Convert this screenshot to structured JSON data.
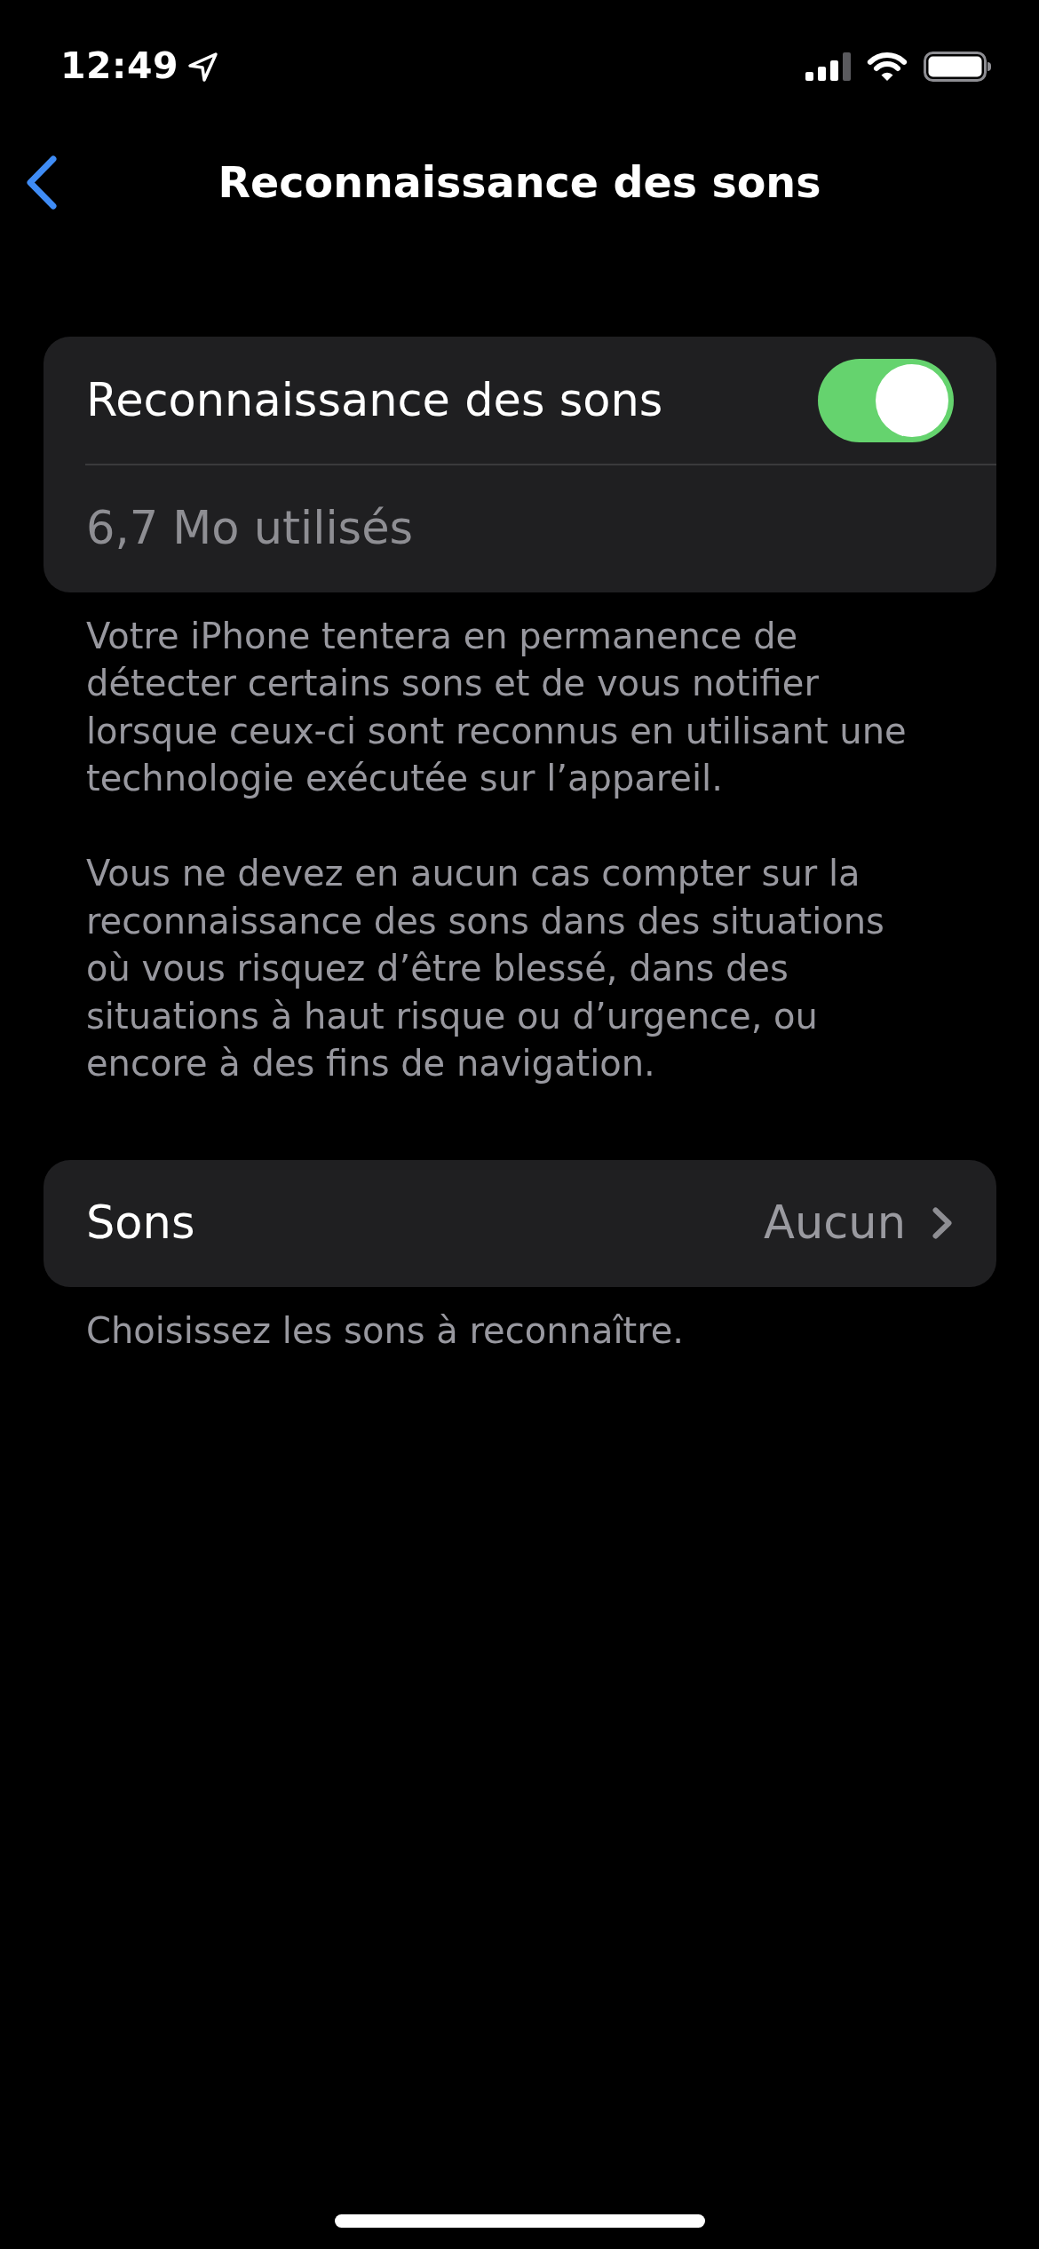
{
  "status_bar": {
    "time": "12:49"
  },
  "nav": {
    "title": "Reconnaissance des sons"
  },
  "sections": [
    {
      "rows": [
        {
          "kind": "toggle",
          "label": "Reconnaissance des sons",
          "on": true
        },
        {
          "kind": "info",
          "label": "6,7 Mo utilisés"
        }
      ],
      "footer": [
        "Votre iPhone tentera en permanence de détecter certains sons et de vous notifier lorsque ceux-ci sont reconnus en utilisant une technologie exécutée sur l’appareil.",
        "Vous ne devez en aucun cas compter sur la reconnaissance des sons dans des situations où vous risquez d’être blessé, dans des situations à haut risque ou d’urgence, ou encore à des fins de navigation."
      ]
    },
    {
      "rows": [
        {
          "kind": "link",
          "label": "Sons",
          "value": "Aucun"
        }
      ],
      "footer": [
        "Choisissez les sons à reconnaître."
      ]
    }
  ]
}
